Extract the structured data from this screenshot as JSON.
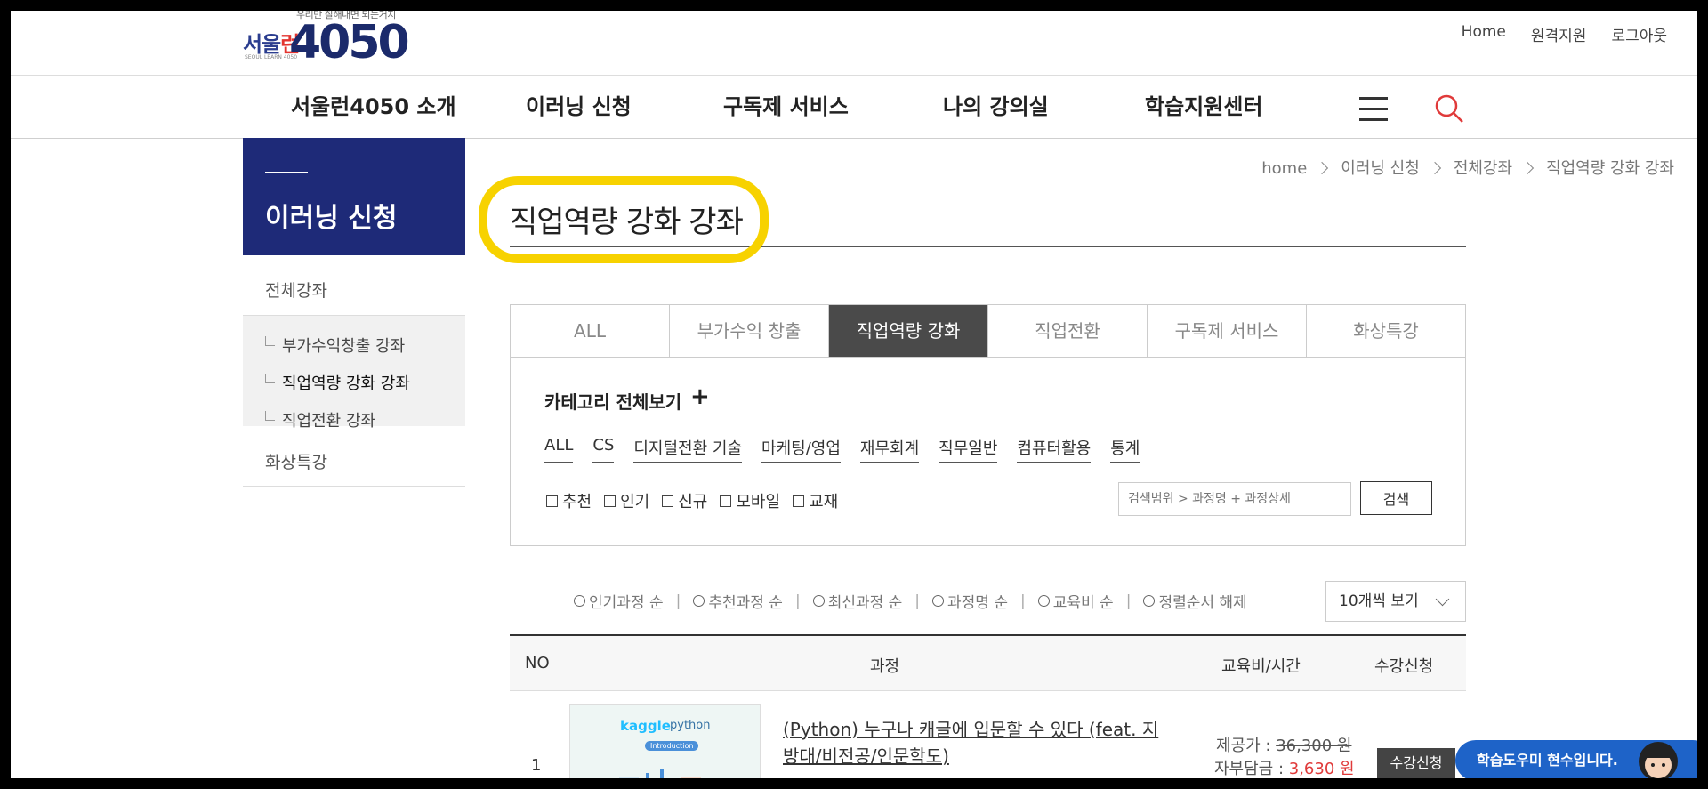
{
  "logo": {
    "tagline": "우리만 잘해내면 되는거지",
    "brand_prefix": "서울",
    "brand_accent": "런",
    "brand_number": "4050",
    "brand_sub": "SEOUL LEARN 4050"
  },
  "util_links": [
    "Home",
    "원격지원",
    "로그아웃"
  ],
  "gnb": [
    "서울런4050 소개",
    "이러닝 신청",
    "구독제 서비스",
    "나의 강의실",
    "학습지원센터"
  ],
  "lnb": {
    "title": "이러닝 신청",
    "items": [
      "전체강좌",
      "화상특강"
    ],
    "sub_items": [
      "부가수익창출 강좌",
      "직업역량 강화 강좌",
      "직업전환 강좌"
    ]
  },
  "breadcrumb": [
    "home",
    "이러닝 신청",
    "전체강좌",
    "직업역량 강화 강좌"
  ],
  "page_title": "직업역량 강화 강좌",
  "tabs": [
    "ALL",
    "부가수익 창출",
    "직업역량 강화",
    "직업전환",
    "구독제 서비스",
    "화상특강"
  ],
  "filter": {
    "category_title": "카테고리 전체보기",
    "categories": [
      "ALL",
      "CS",
      "디지털전환 기술",
      "마케팅/영업",
      "재무회계",
      "직무일반",
      "컴퓨터활용",
      "통계"
    ],
    "checkboxes": [
      "추천",
      "인기",
      "신규",
      "모바일",
      "교재"
    ],
    "search_placeholder": "검색범위 > 과정명 + 과정상세",
    "search_button": "검색"
  },
  "sort_options": [
    "인기과정 순",
    "추천과정 순",
    "최신과정 순",
    "과정명 순",
    "교육비 순",
    "정렬순서 해제"
  ],
  "per_page": "10개씩 보기",
  "table_headers": {
    "no": "NO",
    "course": "과정",
    "fee": "교육비/시간",
    "apply": "수강신청"
  },
  "rows": [
    {
      "no": "1",
      "thumb_kaggle": "kaggle",
      "thumb_python": "python",
      "thumb_badge": "Introduction",
      "title": "(Python) 누구나 캐글에 입문할 수 있다 (feat. 지방대/비전공/인문학도)",
      "price_label": "제공가 : ",
      "price": "36,300 원",
      "self_pay_label": "자부담금 : ",
      "self_pay": "3,630 원",
      "apply": "수강신청"
    }
  ],
  "helper": "학습도우미 현수입니다."
}
